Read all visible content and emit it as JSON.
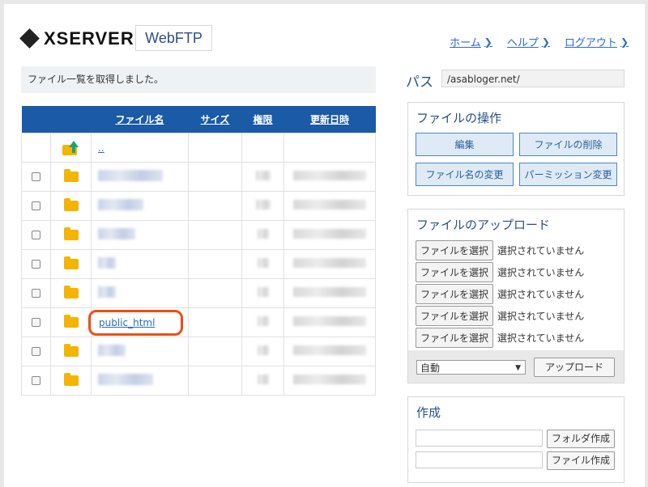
{
  "header": {
    "brand": "XSERVER",
    "product": "WebFTP",
    "nav": [
      {
        "label": "ホーム",
        "icon": "chevron-right-icon"
      },
      {
        "label": "ヘルプ",
        "icon": "chevron-right-icon"
      },
      {
        "label": "ログアウト",
        "icon": "chevron-right-icon"
      }
    ]
  },
  "message": "ファイル一覧を取得しました。",
  "table": {
    "columns": [
      "",
      "",
      "ファイル名",
      "サイズ",
      "権限",
      "更新日時"
    ],
    "parent_label": "..",
    "highlighted_file": "public_html"
  },
  "path": {
    "label": "パス",
    "value": "/asabloger.net/"
  },
  "operations": {
    "title": "ファイルの操作",
    "buttons": [
      "編集",
      "ファイルの削除",
      "ファイル名の変更",
      "パーミッション変更"
    ]
  },
  "upload": {
    "title": "ファイルのアップロード",
    "choose_label": "ファイルを選択",
    "none_label": "選択されていません",
    "mode_value": "自動",
    "upload_button": "アップロード"
  },
  "create": {
    "title": "作成",
    "folder_button": "フォルダ作成",
    "file_button": "ファイル作成"
  },
  "colors": {
    "table_header": "#1b5aa6",
    "highlight": "#f04e13",
    "link": "#2a6cc4"
  }
}
